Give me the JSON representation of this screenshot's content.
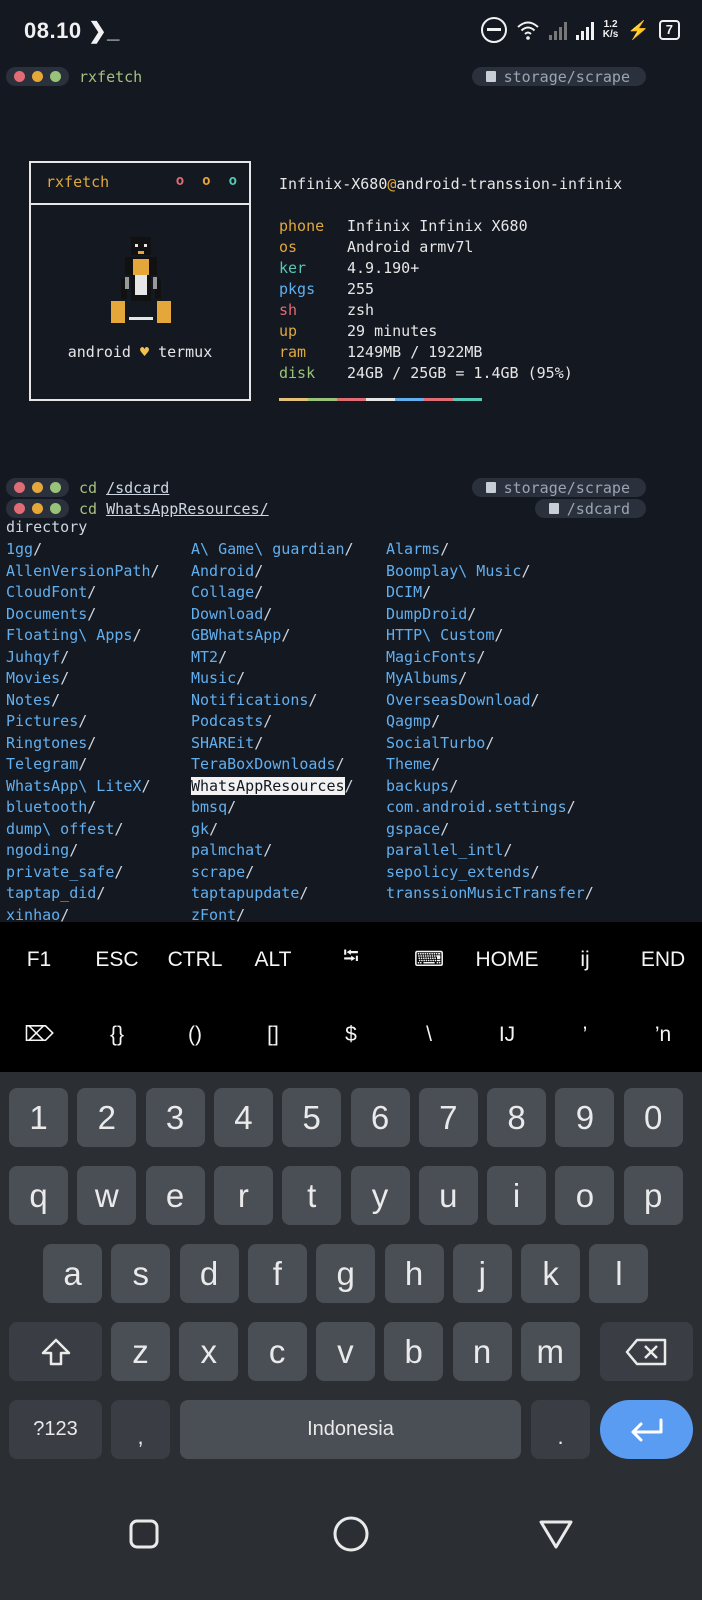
{
  "status_bar": {
    "time": "08.10",
    "prompt_glyph": "❯_",
    "net_speed_top": "1.2",
    "net_speed_bottom": "K/s",
    "battery": "7"
  },
  "top_prompt": {
    "command": "rxfetch",
    "path": "storage/scrape"
  },
  "fetch_box": {
    "title": "rxfetch",
    "dot1": "o",
    "dot2": "o",
    "dot3": "o",
    "caption_left": "android",
    "caption_heart": "♥",
    "caption_right": "termux"
  },
  "host": {
    "user": "Infinix-X680",
    "at": "@",
    "machine": "android-transsion-infinix"
  },
  "info": [
    {
      "key": "phone",
      "value": "Infinix Infinix X680"
    },
    {
      "key": "os",
      "value": "Android armv7l"
    },
    {
      "key": "ker",
      "value": "4.9.190+"
    },
    {
      "key": "pkgs",
      "value": "255"
    },
    {
      "key": "sh",
      "value": "zsh"
    },
    {
      "key": "up",
      "value": "29 minutes"
    },
    {
      "key": "ram",
      "value": "1249MB / 1922MB"
    },
    {
      "key": "disk",
      "value": "24GB / 25GB = 1.4GB (95%)"
    }
  ],
  "palette": [
    "#e5c07b",
    "#98c379",
    "#e06c75",
    "#e6e6e6",
    "#61afef",
    "#e06c75",
    "#56c8b5"
  ],
  "prompt2": {
    "command": "cd",
    "arg": "/sdcard",
    "path": "storage/scrape"
  },
  "prompt3": {
    "command": "cd",
    "arg": "WhatsAppResources/",
    "path": "/sdcard"
  },
  "directory_label": "directory",
  "listing": {
    "col1": [
      "1gg",
      "AllenVersionPath",
      "CloudFont",
      "Documents",
      "Floating\\ Apps",
      "Juhqyf",
      "Movies",
      "Notes",
      "Pictures",
      "Ringtones",
      "Telegram",
      "WhatsApp\\ LiteX",
      "bluetooth",
      "dump\\ offest",
      "ngoding",
      "private_safe",
      "taptap_did",
      "xinhao"
    ],
    "col2": [
      "A\\ Game\\ guardian",
      "Android",
      "Collage",
      "Download",
      "GBWhatsApp",
      "MT2",
      "Music",
      "Notifications",
      "Podcasts",
      "SHAREit",
      "TeraBoxDownloads",
      "WhatsAppResources",
      "bmsq",
      "gk",
      "palmchat",
      "scrape",
      "taptapupdate",
      "zFont"
    ],
    "col3": [
      "Alarms",
      "Boomplay\\ Music",
      "DCIM",
      "DumpDroid",
      "HTTP\\ Custom",
      "MagicFonts",
      "MyAlbums",
      "OverseasDownload",
      "Qagmp",
      "SocialTurbo",
      "Theme",
      "backups",
      "com.android.settings",
      "gspace",
      "parallel_intl",
      "sepolicy_extends",
      "transsionMusicTransfer"
    ],
    "selected": "WhatsAppResources",
    "slash": "/"
  },
  "extra_keys": {
    "row1": [
      "F1",
      "ESC",
      "CTRL",
      "ALT",
      "⭾",
      "⌨",
      "HOME",
      "ij",
      "END"
    ],
    "row2": [
      "⌦",
      "{}",
      "()",
      "[]",
      "$",
      "\\",
      "IJ",
      "’",
      "’n"
    ]
  },
  "keyboard": {
    "numbers": [
      "1",
      "2",
      "3",
      "4",
      "5",
      "6",
      "7",
      "8",
      "9",
      "0"
    ],
    "row_q": [
      "q",
      "w",
      "e",
      "r",
      "t",
      "y",
      "u",
      "i",
      "o",
      "p"
    ],
    "row_a": [
      "a",
      "s",
      "d",
      "f",
      "g",
      "h",
      "j",
      "k",
      "l"
    ],
    "row_z": [
      "z",
      "x",
      "c",
      "v",
      "b",
      "n",
      "m"
    ],
    "symbols_label": "?123",
    "comma": ",",
    "space_label": "Indonesia",
    "period": "."
  }
}
